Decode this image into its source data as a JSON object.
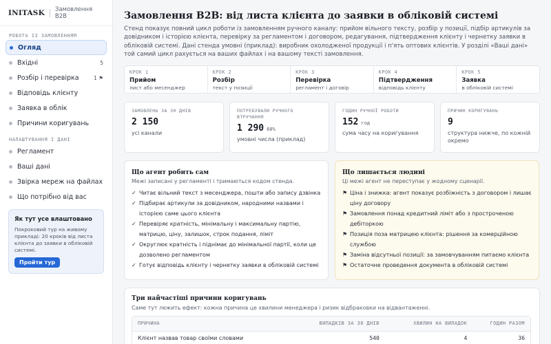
{
  "brand": {
    "logo": "INITASK",
    "subtitle": "Замовлення B2B"
  },
  "sidebar": {
    "section_work": "РОБОТА ІЗ ЗАМОВЛЕННЯМ",
    "work_items": [
      {
        "label": "Огляд",
        "count": "",
        "active": true
      },
      {
        "label": "Вхідні",
        "count": "5"
      },
      {
        "label": "Розбір і перевірка",
        "count": "1 ⚑"
      },
      {
        "label": "Відповідь клієнту",
        "count": ""
      },
      {
        "label": "Заявка в облік",
        "count": ""
      },
      {
        "label": "Причини коригувань",
        "count": ""
      }
    ],
    "section_settings": "НАЛАШТУВАННЯ І ДАНІ",
    "settings_items": [
      {
        "label": "Регламент"
      },
      {
        "label": "Ваші дані"
      },
      {
        "label": "Звірка мереж на файлах"
      },
      {
        "label": "Що потрібно від вас"
      }
    ],
    "tour": {
      "title": "Як тут усе влаштовано",
      "text": "Покроковий тур на живому прикладі: 20 кроків від листа клієнта до заявки в обліковій системі.",
      "button": "Пройти тур"
    }
  },
  "main": {
    "title": "Замовлення B2B: від листа клієнта до заявки в обліковій системі",
    "description": "Стенд показує повний цикл роботи із замовленням ручного каналу: прийом вільного тексту, розбір у позиції, підбір артикулів за довідником і історією клієнта, перевірку за регламентом і договором, редагування, підтвердження клієнту і чернетку заявки в обліковій системі. Дані стенда умовні (приклад): виробник охолодженої продукції і п'ять оптових клієнтів. У розділі «Ваші дані» той самий цикл рахується на ваших файлах і на вашому тексті замовлення.",
    "steps": [
      {
        "num": "КРОК 1",
        "name": "Прийом",
        "desc": "лист або месенджер"
      },
      {
        "num": "КРОК 2",
        "name": "Розбір",
        "desc": "текст у позиції"
      },
      {
        "num": "КРОК 3",
        "name": "Перевірка",
        "desc": "регламент і договір"
      },
      {
        "num": "КРОК 4",
        "name": "Підтвердження",
        "desc": "відповідь клієнту"
      },
      {
        "num": "КРОК 5",
        "name": "Заявка",
        "desc": "в обліковій системі"
      }
    ],
    "stats": [
      {
        "label": "ЗАМОВЛЕНЬ ЗА 30 ДНІВ",
        "value": "2 150",
        "unit": "",
        "desc": "усі канали"
      },
      {
        "label": "ПОТРЕБУВАЛИ РУЧНОГО ВТРУЧАННЯ",
        "value": "1 290",
        "unit": "60%",
        "desc": "умовні числа (приклад)"
      },
      {
        "label": "ГОДИН РУЧНОЇ РОБОТИ",
        "value": "152",
        "unit": "год",
        "desc": "сума часу на коригування"
      },
      {
        "label": "ПРИЧИН КОРИГУВАНЬ",
        "value": "9",
        "unit": "",
        "desc": "структура нижче, по кожній окремо"
      }
    ],
    "agent_panel": {
      "title": "Що агент робить сам",
      "subtitle": "Межі записані у регламенті і тримаються кодом стенда.",
      "mark": "✓",
      "items": [
        "Читає вільний текст з месенджера, пошти або запису дзвінка",
        "Підбирає артикули за довідником, народними назвами і історією саме цього клієнта",
        "Перевіряє кратність, мінімальну і максимальну партію, матрицю, ціну, залишок, строк подання, ліміт",
        "Округлює кратність і піднімає до мінімальної партії, коли це дозволено регламентом",
        "Готує відповідь клієнту і чернетку заявки в обліковій системі"
      ]
    },
    "people_panel": {
      "title": "Що лишається людині",
      "subtitle": "Ці межі агент не переступає у жодному сценарії.",
      "mark": "⚑",
      "items": [
        "Ціна і знижка: агент показує розбіжність з договором і лишає ціну договору",
        "Замовлення понад кредитний ліміт або з простроченою дебіторкою",
        "Позиція поза матрицею клієнта: рішення за комерційною службою",
        "Заміна відсутньої позиції: за замовчуванням питаємо клієнта",
        "Остаточне проведення документа в обліковій системі"
      ]
    },
    "reasons": {
      "title": "Три найчастіші причини коригувань",
      "subtitle": "Саме тут лежить ефект: кожна причина це хвилини менеджера і ризик відбраковки на відвантаженні.",
      "headers": [
        "ПРИЧИНА",
        "ВИПАДКІВ ЗА 30 ДНІВ",
        "ХВИЛИН НА ВИПАДОК",
        "ГОДИН РАЗОМ"
      ],
      "rows": [
        [
          "Клієнт назвав товар своїми словами",
          "540",
          "4",
          "36"
        ]
      ]
    }
  }
}
